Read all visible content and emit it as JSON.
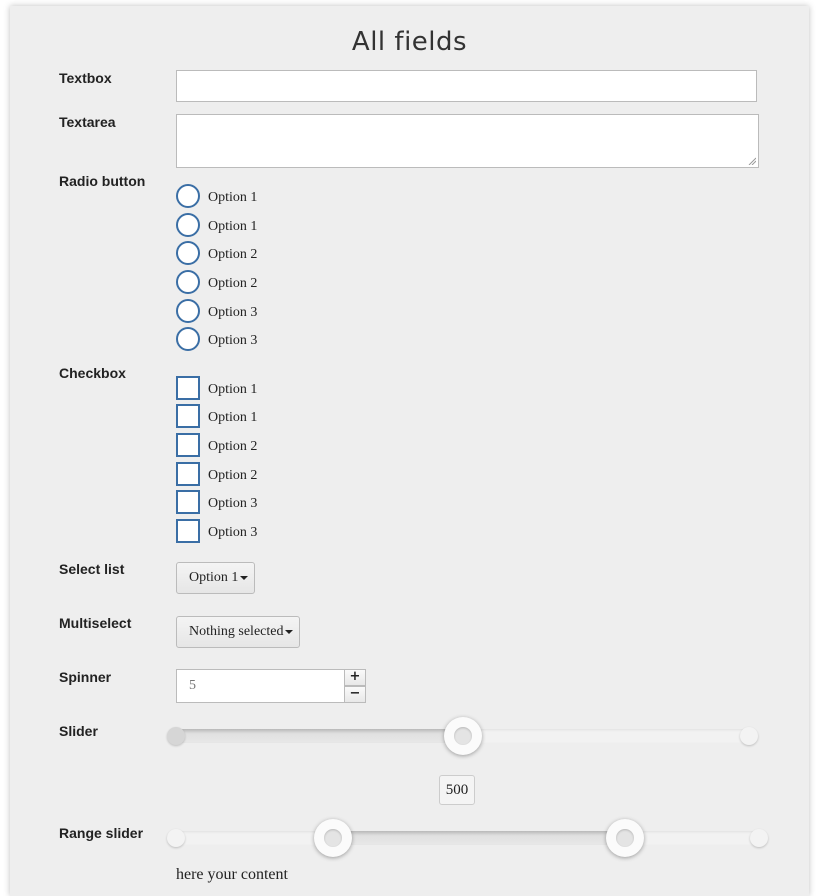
{
  "form": {
    "title": "All fields",
    "labels": {
      "textbox": "Textbox",
      "textarea": "Textarea",
      "radio": "Radio button",
      "checkbox": "Checkbox",
      "select": "Select list",
      "multiselect": "Multiselect",
      "spinner": "Spinner",
      "slider": "Slider",
      "range_slider": "Range slider"
    },
    "textbox_value": "",
    "textarea_value": "",
    "radio_options": [
      "Option 1",
      "Option 1",
      "Option 2",
      "Option 2",
      "Option 3",
      "Option 3"
    ],
    "checkbox_options": [
      "Option 1",
      "Option 1",
      "Option 2",
      "Option 2",
      "Option 3",
      "Option 3"
    ],
    "select_value": "Option 1",
    "multiselect_value": "Nothing selected",
    "spinner": {
      "value": "5",
      "increment": "+",
      "decrement": "−"
    },
    "slider": {
      "value": "500",
      "fraction": 0.5
    },
    "range_slider": {
      "low_fraction": 0.27,
      "high_fraction": 0.77
    },
    "content_text": "here your content"
  },
  "colors": {
    "panel_bg": "#eeeeee",
    "control_border": "#3a6ea5"
  }
}
